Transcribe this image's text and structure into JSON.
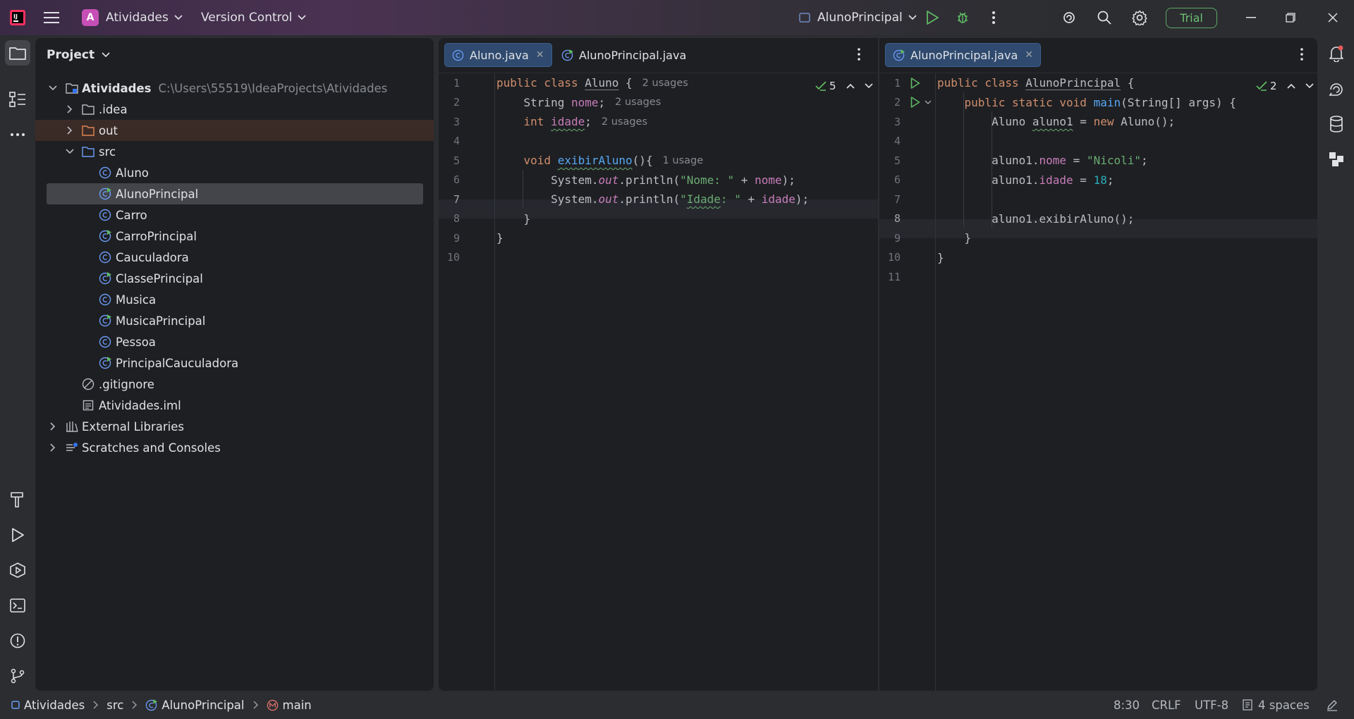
{
  "titlebar": {
    "project_initial": "A",
    "project_name": "Atividades",
    "vcs_label": "Version Control",
    "run_config": "AlunoPrincipal",
    "trial_label": "Trial"
  },
  "project_panel": {
    "title": "Project",
    "tree": [
      {
        "label": "Atividades",
        "hint": "C:\\Users\\55519\\IdeaProjects\\Atividades",
        "kind": "module-folder"
      },
      {
        "label": ".idea",
        "kind": "folder"
      },
      {
        "label": "out",
        "kind": "folder-excluded"
      },
      {
        "label": "src",
        "kind": "source-folder"
      },
      {
        "label": "Aluno",
        "kind": "class"
      },
      {
        "label": "AlunoPrincipal",
        "kind": "main-class"
      },
      {
        "label": "Carro",
        "kind": "class"
      },
      {
        "label": "CarroPrincipal",
        "kind": "main-class"
      },
      {
        "label": "Cauculadora",
        "kind": "class"
      },
      {
        "label": "ClassePrincipal",
        "kind": "main-class"
      },
      {
        "label": "Musica",
        "kind": "class"
      },
      {
        "label": "MusicaPrincipal",
        "kind": "main-class"
      },
      {
        "label": "Pessoa",
        "kind": "class"
      },
      {
        "label": "PrincipalCauculadora",
        "kind": "main-class"
      },
      {
        "label": ".gitignore",
        "kind": "ignore-file"
      },
      {
        "label": "Atividades.iml",
        "kind": "iml-file"
      },
      {
        "label": "External Libraries",
        "kind": "library"
      },
      {
        "label": "Scratches and Consoles",
        "kind": "scratches"
      }
    ]
  },
  "editor_left": {
    "tabs": [
      {
        "label": "Aluno.java",
        "active": true
      },
      {
        "label": "AlunoPrincipal.java",
        "active": false
      }
    ],
    "inspection_count": "5",
    "line_numbers": [
      "1",
      "2",
      "3",
      "4",
      "5",
      "6",
      "7",
      "8",
      "9",
      "10"
    ],
    "code": {
      "l1_a": "public class ",
      "l1_b": "Aluno",
      "l1_c": " {",
      "l1_hint": "2 usages",
      "l2_a": "    String ",
      "l2_b": "nome",
      "l2_c": ";",
      "l2_hint": "2 usages",
      "l3_a": "    int ",
      "l3_b": "idade",
      "l3_c": ";",
      "l3_hint": "2 usages",
      "l5_a": "    void ",
      "l5_b": "exibirAluno",
      "l5_c": "(){",
      "l5_hint": "1 usage",
      "l6_a": "        System.",
      "l6_b": "out",
      "l6_c": ".println(",
      "l6_d": "\"Nome: \"",
      "l6_e": " + ",
      "l6_f": "nome",
      "l6_g": ");",
      "l7_a": "        System.",
      "l7_b": "out",
      "l7_c": ".println(",
      "l7_d1": "\"",
      "l7_d2": "Idade",
      "l7_d3": ": \"",
      "l7_e": " + ",
      "l7_f": "idade",
      "l7_g": ");",
      "l8": "    }",
      "l9": "}"
    }
  },
  "editor_right": {
    "tabs": [
      {
        "label": "AlunoPrincipal.java",
        "active": true
      }
    ],
    "inspection_count": "2",
    "line_numbers": [
      "1",
      "2",
      "3",
      "4",
      "5",
      "6",
      "7",
      "8",
      "9",
      "10",
      "11"
    ],
    "code": {
      "l1_a": "public class ",
      "l1_b": "AlunoPrincipal",
      "l1_c": " {",
      "l2_a": "    public static void ",
      "l2_b": "main",
      "l2_c": "(String[] args) {",
      "l3_a": "        Aluno ",
      "l3_b": "aluno1",
      "l3_c": " = ",
      "l3_d": "new",
      "l3_e": " Aluno();",
      "l5_a": "        aluno1.",
      "l5_b": "nome",
      "l5_c": " = ",
      "l5_d": "\"Nicoli\"",
      "l5_e": ";",
      "l6_a": "        aluno1.",
      "l6_b": "idade",
      "l6_c": " = ",
      "l6_d": "18",
      "l6_e": ";",
      "l8": "        aluno1.exibirAluno();",
      "l9": "    }",
      "l10": "}"
    }
  },
  "statusbar": {
    "breadcrumbs": [
      "Atividades",
      "src",
      "AlunoPrincipal",
      "main"
    ],
    "caret": "8:30",
    "line_sep": "CRLF",
    "encoding": "UTF-8",
    "indent": "4 spaces"
  },
  "colors": {
    "accent": "#3574f0",
    "keyword": "#cf8e6d",
    "field": "#c77dbb",
    "function": "#56a8f5",
    "string": "#6aab73",
    "number": "#2aacb8",
    "trial": "#6fbf73"
  }
}
